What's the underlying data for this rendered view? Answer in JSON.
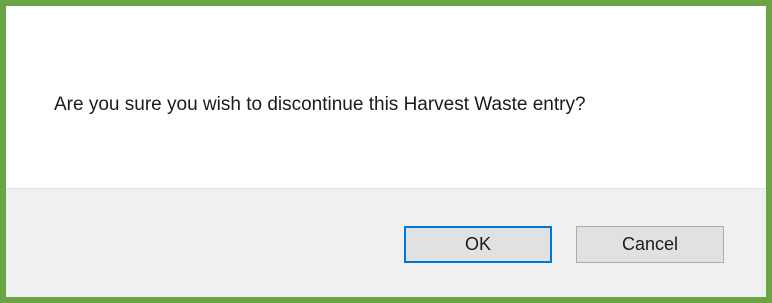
{
  "dialog": {
    "message": "Are you sure you wish to discontinue this Harvest Waste entry?",
    "ok_label": "OK",
    "cancel_label": "Cancel"
  },
  "colors": {
    "frame_border": "#6aa444",
    "button_bar": "#f0f0f0",
    "default_button_border": "#0078d7"
  }
}
